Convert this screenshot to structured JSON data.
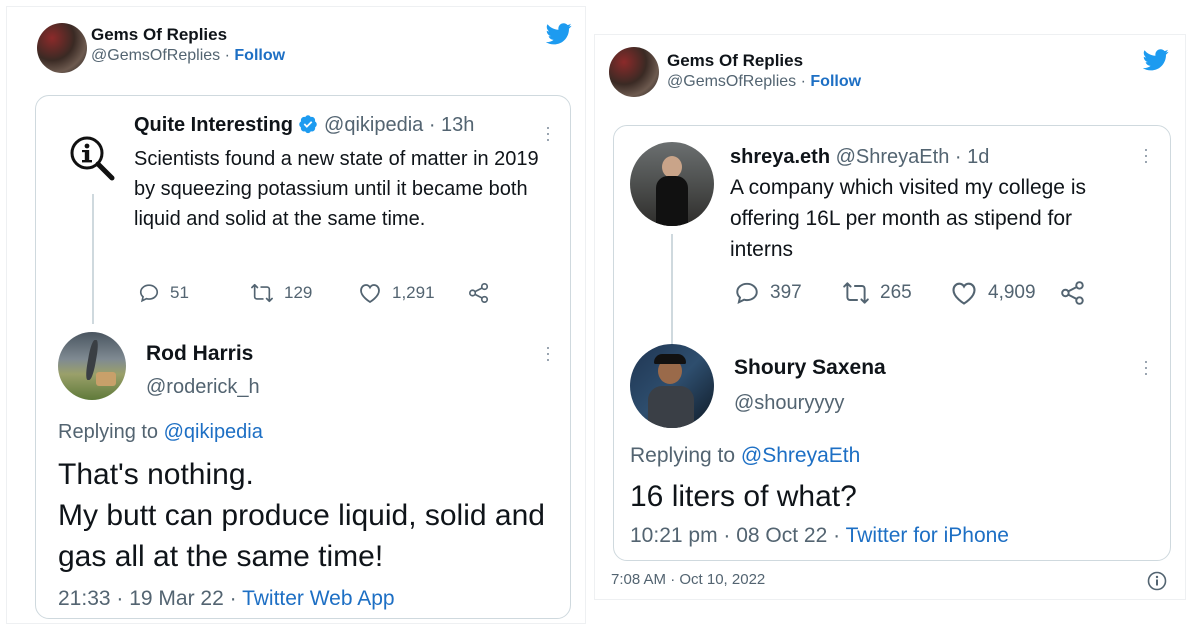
{
  "left": {
    "header": {
      "account_name": "Gems Of Replies",
      "account_handle": "@GemsOfReplies",
      "separator": "·",
      "follow_label": "Follow"
    },
    "quoted_tweet": {
      "name": "Quite Interesting",
      "handle": "@qikipedia",
      "time": "· 13h",
      "text": "Scientists found a new state of matter in 2019 by squeezing potassium until it became both liquid and solid at the same time.",
      "replies": "51",
      "retweets": "129",
      "likes": "1,291"
    },
    "reply": {
      "name": "Rod Harris",
      "handle": "@roderick_h",
      "replying_prefix": "Replying to",
      "replying_to": "@qikipedia",
      "body_line1": "That's nothing.",
      "body_line2": "My butt can produce liquid, solid and gas all at the same time!",
      "timestamp": "21:33 · 19 Mar 22 ·",
      "source": "Twitter Web App"
    }
  },
  "right": {
    "header": {
      "account_name": "Gems Of Replies",
      "account_handle": "@GemsOfReplies",
      "separator": "·",
      "follow_label": "Follow"
    },
    "quoted_tweet": {
      "name": "shreya.eth",
      "handle": "@ShreyaEth",
      "time": "· 1d",
      "text": "A company which visited my college is offering 16L per month as stipend for interns",
      "replies": "397",
      "retweets": "265",
      "likes": "4,909"
    },
    "reply": {
      "name": "Shoury Saxena",
      "handle": "@shouryyyy",
      "replying_prefix": "Replying to",
      "replying_to": "@ShreyaEth",
      "body_line1": "16 liters of what?",
      "timestamp": "10:21 pm · 08 Oct 22 ·",
      "source": "Twitter for iPhone"
    },
    "footer_time": "7:08 AM · Oct 10, 2022"
  },
  "colors": {
    "link_blue": "#1d6fc4",
    "twitter_blue": "#1d9bf0",
    "muted_gray": "#536471",
    "border_gray": "#cfd9de"
  },
  "icons": [
    "twitter-bird-icon",
    "reply-icon",
    "retweet-icon",
    "like-icon",
    "share-icon",
    "more-icon",
    "verified-icon",
    "qi-logo-icon",
    "info-icon"
  ]
}
